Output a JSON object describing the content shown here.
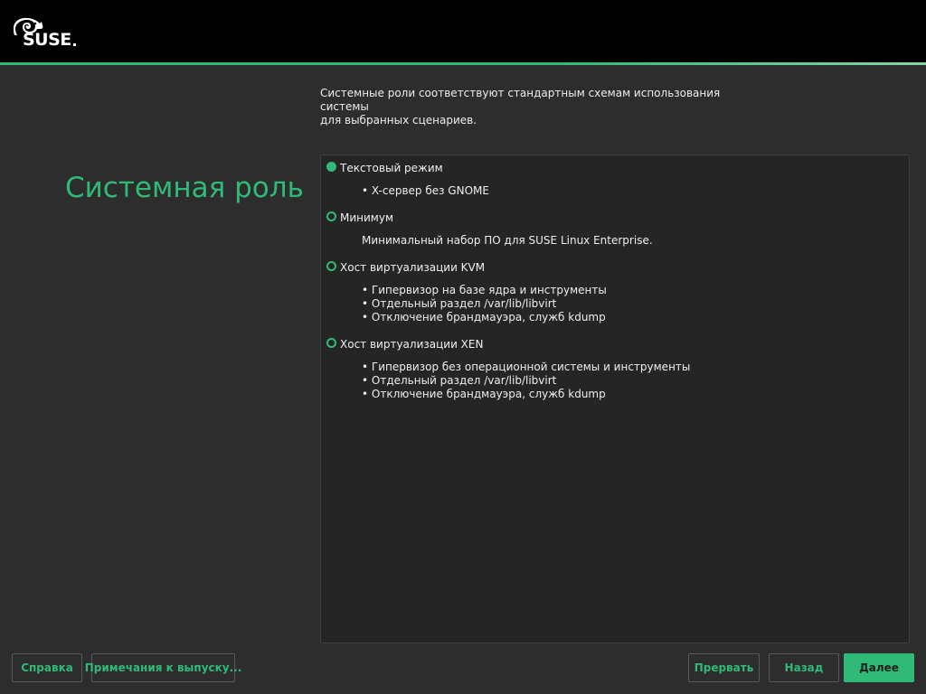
{
  "header": {
    "logo_text": "SUSE"
  },
  "page": {
    "title": "Системная роль",
    "intro_line1": "Системные роли соответствуют стандартным схемам использования системы",
    "intro_line2": "для выбранных сценариев."
  },
  "roles": [
    {
      "label": "Текстовый режим",
      "selected": true,
      "description": [
        "• X-сервер без GNOME"
      ]
    },
    {
      "label": "Минимум",
      "selected": false,
      "description": [
        "Минимальный набор ПО для SUSE Linux Enterprise."
      ]
    },
    {
      "label": "Хост виртуализации KVM",
      "selected": false,
      "description": [
        "• Гипервизор на базе ядра и инструменты",
        "• Отдельный раздел /var/lib/libvirt",
        "• Отключение брандмауэра, служб kdump"
      ]
    },
    {
      "label": "Хост виртуализации XEN",
      "selected": false,
      "description": [
        "• Гипервизор без операционной системы и инструменты",
        "• Отдельный раздел /var/lib/libvirt",
        "• Отключение брандмауэра, служб kdump"
      ]
    }
  ],
  "buttons": {
    "help": "Справка",
    "release_notes": "Примечания к выпуску...",
    "abort": "Прервать",
    "back": "Назад",
    "next": "Далее"
  },
  "colors": {
    "accent": "#30ba78",
    "background": "#2d2d2d",
    "header": "#000000"
  }
}
